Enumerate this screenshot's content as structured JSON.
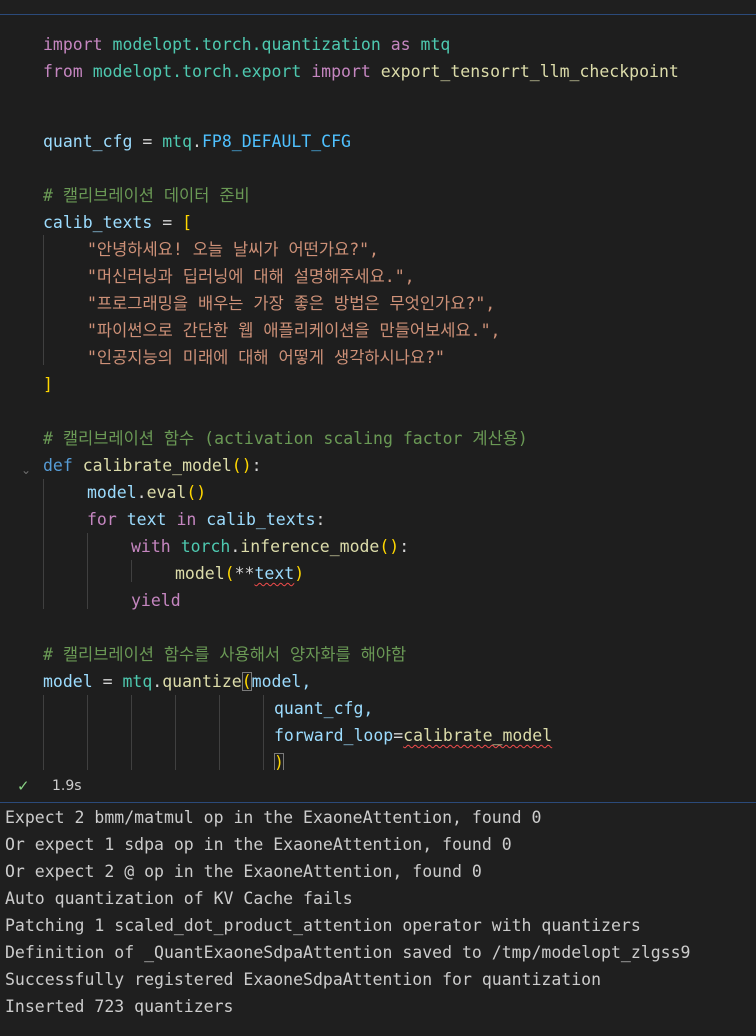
{
  "code": {
    "line1": {
      "kw": "import",
      "mod": "modelopt.torch.quantization",
      "as": "as",
      "alias": "mtq"
    },
    "line2": {
      "kw": "from",
      "mod": "modelopt.torch.export",
      "imp": "import",
      "name": "export_tensorrt_llm_checkpoint"
    },
    "line4": {
      "var": "quant_cfg",
      "eq": " = ",
      "mod": "mtq",
      "dot": ".",
      "const": "FP8_DEFAULT_CFG"
    },
    "comment1": "# 캘리브레이션 데이터 준비",
    "line7": {
      "var": "calib_texts",
      "eq": " = ",
      "open": "["
    },
    "strings": [
      "\"안녕하세요! 오늘 날씨가 어떤가요?\",",
      "\"머신러닝과 딥러닝에 대해 설명해주세요.\",",
      "\"프로그래밍을 배우는 가장 좋은 방법은 무엇인가요?\",",
      "\"파이썬으로 간단한 웹 애플리케이션을 만들어보세요.\",",
      "\"인공지능의 미래에 대해 어떻게 생각하시나요?\""
    ],
    "close": "]",
    "comment2": "# 캘리브레이션 함수 (activation scaling factor 계산용)",
    "def": {
      "kw": "def",
      "name": "calibrate_model",
      "paren": "()",
      "colon": ":"
    },
    "eval": {
      "obj": "model",
      "dot": ".",
      "fn": "eval",
      "paren": "()"
    },
    "for": {
      "kw": "for",
      "var": "text",
      "in": "in",
      "iter": "calib_texts",
      "colon": ":"
    },
    "with": {
      "kw": "with",
      "obj": "torch",
      "dot": ".",
      "fn": "inference_mode",
      "paren": "()",
      "colon": ":"
    },
    "call": {
      "fn": "model",
      "open": "(",
      "op": "**",
      "arg": "text",
      "close": ")"
    },
    "yield": "yield",
    "comment3": "# 캘리브레이션 함수를 사용해서 양자화를 해야함",
    "quantize": {
      "var": "model",
      "eq": " = ",
      "mod": "mtq",
      "dot": ".",
      "fn": "quantize",
      "open": "(",
      "arg1": "model,"
    },
    "arg2": "quant_cfg,",
    "arg3": {
      "key": "forward_loop",
      "eq": "=",
      "val": "calibrate_model"
    },
    "close_paren": ")"
  },
  "status": {
    "icon": "check-icon",
    "time": "1.9s",
    "color": "#89d185"
  },
  "output_lines": [
    "Expect 2 bmm/matmul op in the ExaoneAttention, found 0",
    "Or expect 1 sdpa op in the ExaoneAttention, found 0",
    "Or expect 2 @ op in the ExaoneAttention, found 0",
    "Auto quantization of KV Cache fails",
    "Patching 1 scaled_dot_product_attention operator with quantizers",
    "Definition of _QuantExaoneSdpaAttention saved to /tmp/modelopt_zlgss9",
    "Successfully registered ExaoneSdpaAttention for quantization",
    "Inserted 723 quantizers"
  ]
}
